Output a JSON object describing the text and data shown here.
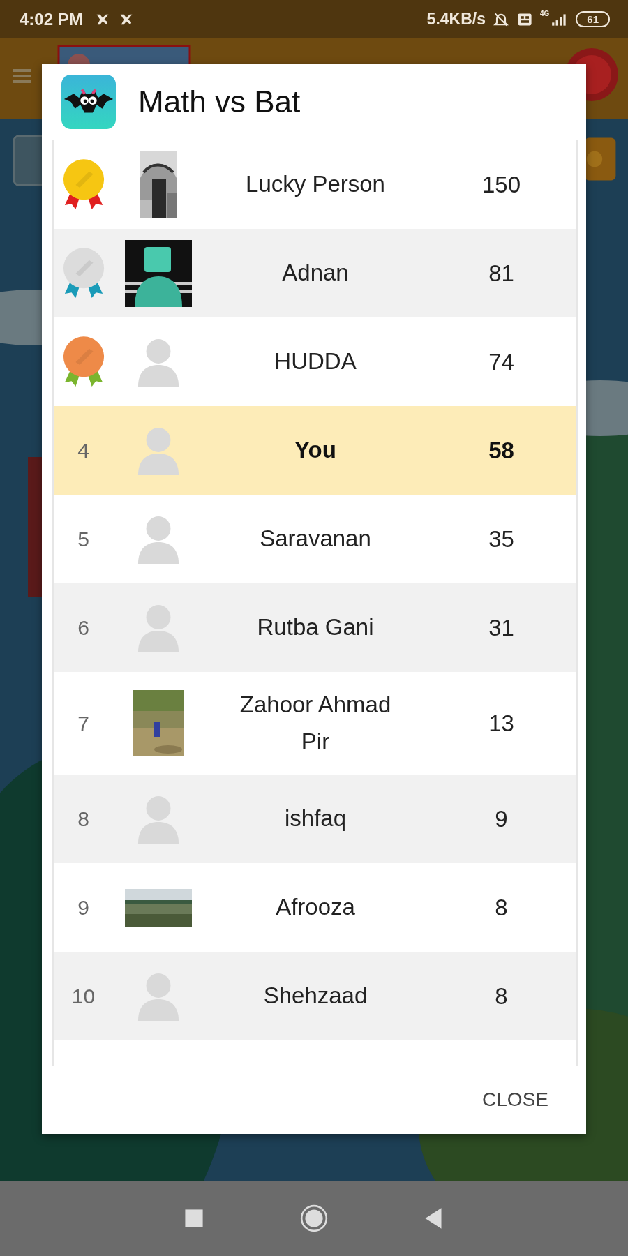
{
  "status_bar": {
    "time": "4:02 PM",
    "speed": "5.4KB/s",
    "network": "4G",
    "battery": "61"
  },
  "dialog": {
    "title": "Math vs Bat",
    "close_button": "CLOSE"
  },
  "leaderboard": [
    {
      "kind": "medal",
      "color": "#f6c612",
      "name": "Lucky Person",
      "score": "150",
      "selected": false
    },
    {
      "kind": "medal",
      "color": "#dcdcdc",
      "name": "Adnan",
      "score": "81",
      "selected": false
    },
    {
      "kind": "medal",
      "color": "#ee8a48",
      "avatar": {
        "kind": "silhouette"
      },
      "name": "HUDDA",
      "score": "74",
      "selected": false
    },
    {
      "kind": "rank",
      "rank": "4",
      "avatar": {
        "kind": "silhouette"
      },
      "name": "You",
      "score": "58",
      "selected": true
    },
    {
      "kind": "rank",
      "rank": "5",
      "avatar": {
        "kind": "silhouette"
      },
      "name": "Saravanan",
      "score": "35",
      "selected": false
    },
    {
      "kind": "rank",
      "rank": "6",
      "avatar": {
        "kind": "silhouette"
      },
      "name": "Rutba Gani",
      "score": "31",
      "selected": false
    },
    {
      "kind": "rank",
      "rank": "7",
      "name": "Zahoor Ahmad Pir",
      "score": "13",
      "selected": false
    },
    {
      "kind": "rank",
      "rank": "8",
      "avatar": {
        "kind": "silhouette"
      },
      "name": "ishfaq",
      "score": "9",
      "selected": false
    },
    {
      "kind": "rank",
      "rank": "9",
      "name": "Afrooza",
      "score": "8",
      "selected": false
    },
    {
      "kind": "rank",
      "rank": "10",
      "avatar": {
        "kind": "silhouette"
      },
      "name": "Shehzaad",
      "score": "8",
      "selected": false
    }
  ]
}
